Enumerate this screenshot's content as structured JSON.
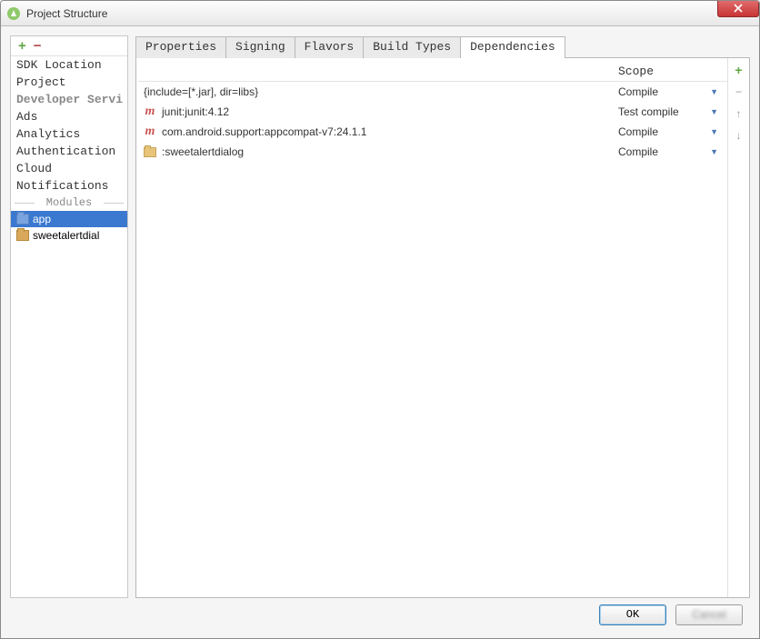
{
  "window": {
    "title": "Project Structure"
  },
  "sidebar": {
    "items": [
      {
        "label": "SDK Location"
      },
      {
        "label": "Project"
      },
      {
        "label": "Developer Servi",
        "header": true
      },
      {
        "label": "Ads"
      },
      {
        "label": "Analytics"
      },
      {
        "label": "Authentication"
      },
      {
        "label": "Cloud"
      },
      {
        "label": "Notifications"
      }
    ],
    "section_label": "Modules",
    "modules": [
      {
        "label": "app",
        "selected": true
      },
      {
        "label": "sweetalertdial"
      }
    ]
  },
  "tabs": [
    {
      "label": "Properties"
    },
    {
      "label": "Signing"
    },
    {
      "label": "Flavors"
    },
    {
      "label": "Build Types"
    },
    {
      "label": "Dependencies",
      "active": true
    }
  ],
  "deps": {
    "scope_header": "Scope",
    "rows": [
      {
        "icon": "none",
        "name": "{include=[*.jar], dir=libs}",
        "scope": "Compile"
      },
      {
        "icon": "m",
        "name": "junit:junit:4.12",
        "scope": "Test compile"
      },
      {
        "icon": "m",
        "name": "com.android.support:appcompat-v7:24.1.1",
        "scope": "Compile"
      },
      {
        "icon": "folder",
        "name": ":sweetalertdialog",
        "scope": "Compile"
      }
    ]
  },
  "buttons": {
    "ok": "OK",
    "cancel": "Cancel"
  }
}
